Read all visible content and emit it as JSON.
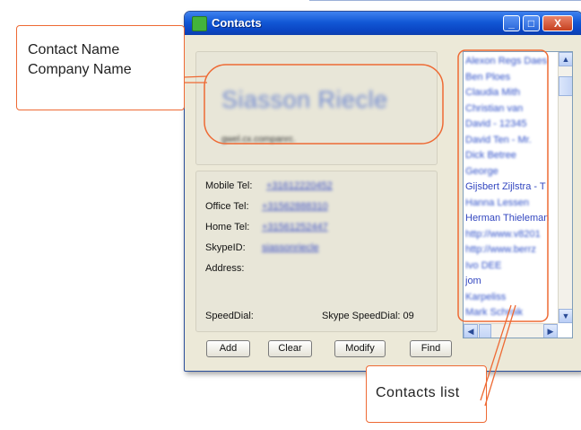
{
  "window": {
    "title": "Contacts",
    "min_glyph": "_",
    "max_glyph": "□",
    "close_glyph": "X"
  },
  "contact": {
    "name": "Siasson Riecle",
    "company": "gwel.cx.companrc."
  },
  "fields": {
    "mobile_label": "Mobile Tel:",
    "mobile_value": "+31612220452",
    "office_label": "Office Tel:",
    "office_value": "+31562888310",
    "home_label": "Home Tel:",
    "home_value": "+31561252447",
    "skype_label": "SkypeID:",
    "skype_value": "siassonriecle",
    "address_label": "Address:",
    "speeddial_label": "SpeedDial:",
    "skype_speeddial_label": "Skype SpeedDial:",
    "skype_speeddial_value": "09"
  },
  "buttons": {
    "add": "Add",
    "clear": "Clear",
    "modify": "Modify",
    "find": "Find"
  },
  "contacts_list": [
    {
      "label": "Alexon Regs Daes",
      "blurred": true
    },
    {
      "label": "Ben Ploes",
      "blurred": true
    },
    {
      "label": "Claudia Mith",
      "blurred": true
    },
    {
      "label": "Christian van",
      "blurred": true
    },
    {
      "label": "David - 12345",
      "blurred": true
    },
    {
      "label": "David Ten - Mr.",
      "blurred": true
    },
    {
      "label": "Dick Betree",
      "blurred": true
    },
    {
      "label": "George",
      "blurred": true
    },
    {
      "label": "Gijsbert Zijlstra - T",
      "blurred": false
    },
    {
      "label": "Hanna Lessen",
      "blurred": true
    },
    {
      "label": "Herman Thieleman",
      "blurred": false
    },
    {
      "label": "http://www.v8201",
      "blurred": true
    },
    {
      "label": "http://www.berrz",
      "blurred": true
    },
    {
      "label": "Ivo DEE",
      "blurred": true
    },
    {
      "label": "jom",
      "blurred": false
    },
    {
      "label": "Karpeliss",
      "blurred": true
    },
    {
      "label": "Mark Schroik",
      "blurred": true
    }
  ],
  "scroll": {
    "up": "▲",
    "down": "▼",
    "left": "◀",
    "right": "▶"
  },
  "annotations": {
    "name_line1": "Contact Name",
    "name_line2": "Company Name",
    "list": "Contacts list"
  },
  "colors": {
    "annotation": "#ee6a34",
    "titlebar": "#0a46c4",
    "link": "#3b4fc4"
  }
}
